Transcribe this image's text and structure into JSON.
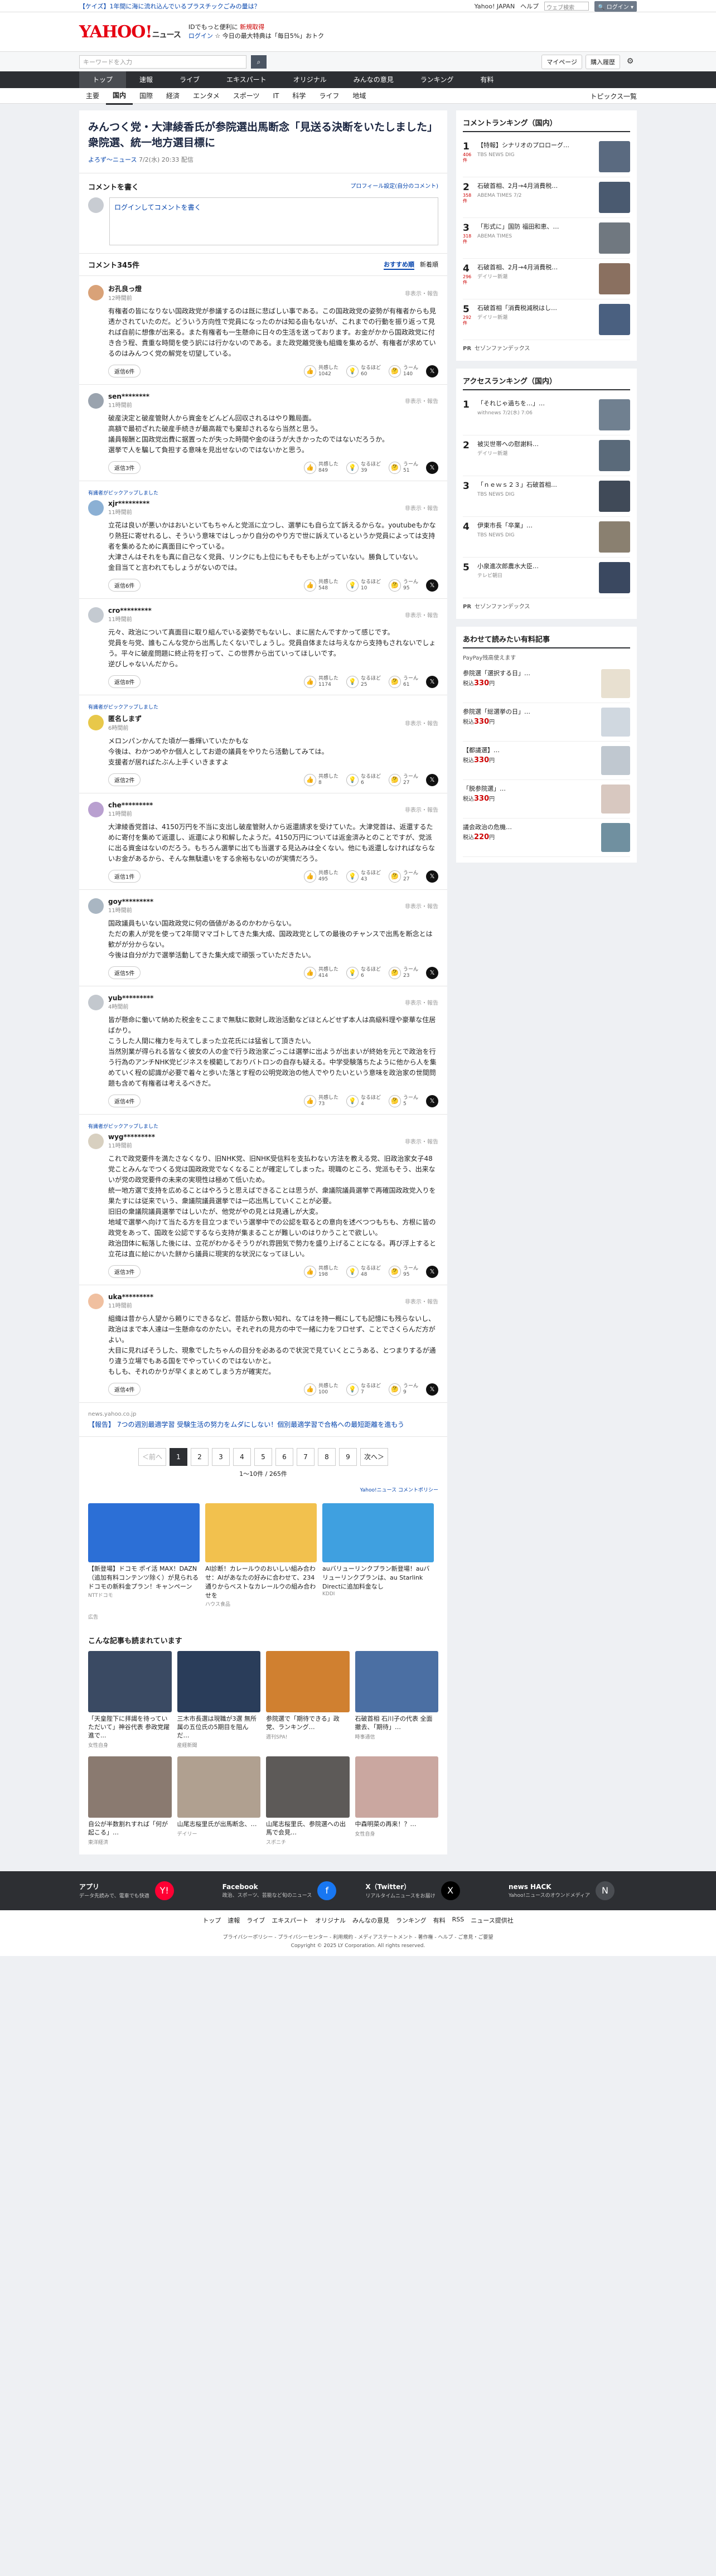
{
  "promo": {
    "ad": "【ケイズ】1年間に海に流れ込んでいるプラスチックごみの量は？",
    "links": [
      "Yahoo! JAPAN",
      "ヘルプ"
    ],
    "search_placeholder": "ウェブ検索",
    "search_label": "🔍 ログイン ▾"
  },
  "header": {
    "logo": "YAHOO!",
    "logo_sub": "ニュース",
    "promo_line1": "IDでもっと便利に",
    "promo_new": "新規取得",
    "promo_line2": "ログイン",
    "promo_line2b": "☆ 今日の最大特典は「毎日5%」おトク"
  },
  "searchbar": {
    "placeholder": "キーワードを入力",
    "mypage": "マイページ",
    "buy": "購入履歴"
  },
  "gnav": [
    "トップ",
    "速報",
    "ライブ",
    "エキスパート",
    "オリジナル",
    "みんなの意見",
    "ランキング",
    "有料"
  ],
  "subnav": [
    "主要",
    "国内",
    "国際",
    "経済",
    "エンタメ",
    "スポーツ",
    "IT",
    "科学",
    "ライフ",
    "地域"
  ],
  "topics": "トピックス一覧",
  "article": {
    "title": "みんつく党・大津綾香氏が参院選出馬断念「見送る決断をいたしました」衆院選、統一地方選目標に",
    "source": "よろず～ニュース",
    "date": "7/2(水) 20:33 配信"
  },
  "write": {
    "title": "コメントを書く",
    "settings": "プロフィール設定(自分のコメント)",
    "box": "ログインしてコメントを書く"
  },
  "comment_head": {
    "title": "コメント345件",
    "sort_recommended": "おすすめ順",
    "sort_new": "新着順"
  },
  "labels": {
    "report": "非表示・報告",
    "expert_pick": "有識者がピックアップしました",
    "replies_suffix": "返信",
    "v1": "共感した",
    "v2": "なるほど",
    "v3": "うーん"
  },
  "comments": [
    {
      "user": "お孔良っ燈",
      "time": "12時間前",
      "color": "#d9a278",
      "text": "有権者の皆になりない国政政党が参議するのは既に悲ばしい事である。この国政政党の姿勢が有権者からも見透かされていたのだ。どういう方向性で党員になったのかは知る由もないが、これまでの行動を振り返って見れば自前に想像が出来る。また有権者も一生懸命に日々の生活を送っております。お金がかから国政政党に付き合う程、貴重な時間を使う訳には行かないのである。また政党離党後も組織を集めるが、有権者が求めているのはみんつく党の解党を切望している。",
      "replies": "返信6件",
      "v1": "1042",
      "v2": "60",
      "v3": "140"
    },
    {
      "user": "sen********",
      "time": "11時間前",
      "color": "#9aa3ae",
      "text": "破産決定と破産管財人から資金をどんどん回収されるはやり難局面。\n高額で最初ざれた破産手続きが最高裁でも棄却されるなら当然と思う。\n議員報酬と国政党出費に据置ったが失った時間や金のほうが大きかったのではないだろうか。\n選挙で人を騙して負担する意味を見出せないのではないかと思う。",
      "replies": "返信3件",
      "v1": "849",
      "v2": "39",
      "v3": "51"
    },
    {
      "user": "xjr*********",
      "time": "11時間前",
      "color": "#8bb0d4",
      "expert": true,
      "text": "立花は良いが悪いかはおいといてもちゃんと党派に立つし、選挙にも自ら立て訴えるからな。youtubeもかなり熱狂に寄せれるし、そういう意味ではしっかり自分のやり方で世に訴えているというか党員によっては支持者を集めるために真面目にやっている。\n大津さんはそれをも真に自己なく党員、リンクにも上位にもそもそも上がっていない。勝負していない。\n金目当てと言われてもしょうがないのでは。",
      "replies": "返信6件",
      "v1": "548",
      "v2": "10",
      "v3": "95"
    },
    {
      "user": "cro*********",
      "time": "11時間前",
      "color": "#c4cad1",
      "text": "元々、政治について真面目に取り組んでいる姿勢でもないし、まに居たんですかって感じです。\n党員を与党、誰もこんな党から出馬したくないでしょうし。党員自体または与えなから支持もされないでしょう。平々に破産問題に終止符を打って、この世界から出ていってほしいです。\n逆びしゃないんだから。",
      "replies": "返信8件",
      "v1": "1174",
      "v2": "25",
      "v3": "61"
    },
    {
      "user": "匿名しまず",
      "time": "6時間前",
      "color": "#e8c84a",
      "expert": true,
      "text": "メロンパンかんてた頃が一番輝いていたかもな\n今後は、わかつめやか個人としてお遊の議員をやりたら活動してみては。\n支援者が居ればたぶん上手くいきますよ",
      "replies": "返信2件",
      "v1": "8",
      "v2": "6",
      "v3": "27"
    },
    {
      "user": "che*********",
      "time": "11時間前",
      "color": "#b9a0d0",
      "text": "大津綾香党首は、4150万円を不当に支出し破産管財人から返還請求を受けていた。大津党首は、返還するために寄付を集めて返還し、返還により和解したようだ。4150万円については返金済みとのことですが、党派に出る資金はないのだろう。もちろん選挙に出ても当選する見込みは全くない。他にも返還しなければならないお金があるから、そんな無駄遣いをする余裕もないのが実情だろう。",
      "replies": "返信1件",
      "v1": "495",
      "v2": "43",
      "v3": "27"
    },
    {
      "user": "goy*********",
      "time": "11時間前",
      "color": "#a9b6c2",
      "text": "国政議員もいない国政政党に何の価値があるのかわからない。\nただの素人が党を使って2年間ママゴトしてきた集大成、国政政党としての最後のチャンスで出馬を断念とは歓がが分からない。\n今後は自分が力で選挙活動してきた集大成で頑張っていただきたい。",
      "replies": "返信5件",
      "v1": "414",
      "v2": "6",
      "v3": "23"
    },
    {
      "user": "yub*********",
      "time": "4時間前",
      "color": "#c3c8ce",
      "text": "皆が懸命に働いて納めた税金をここまで無駄に散財し政治活動などほとんどせず本人は高級料理や豪華な住居ばかり。\nこうした人間に権力を与えてしまった立花氏には猛省して頂きたい。\n当然別業が得られる皆なく彼女の人の金で行う政治家ごっこは選挙に出ようが出まいが終始を元とで政治を行う行為のアンチNHK党ビジネスを模範しておりバトロンの自存も疑える。中学受験落ちたように他から人を集めていく程の認識が必要で着々と歩いた落とす程の公明党政治の他人でやりたいという意味を政治家の世間問題も含めて有権者は考えるべきだ。",
      "replies": "返信4件",
      "v1": "73",
      "v2": "4",
      "v3": "5"
    },
    {
      "user": "wyg*********",
      "time": "11時間前",
      "color": "#d8d0c0",
      "expert": true,
      "text": "これで政党要件を満たさなくなり、旧NHK党、旧NHK受信料を支払わない方法を教える党、旧政治家女子48党ことみんなでつくる党は国政政党でなくなることが確定してしまった。現職のところ、党派もそう、出来ないが党の政党要件の未来の実現性は極めて低いため。\n統一地方選で支持を広めることはやろうと思えばできることは思うが、衆議院議員選挙で再確国政政党入りを果たすには従来でいう、衆議院議員選挙では一応出馬していくことが必要。\n旧旧の衆議院議員選挙ではしいたが、他党がやの見とは見通しが大変。\n地域で選挙へ向けて当たる方を目立つまでいう選挙中での公認を取るとの意向を述べつつもちも、方根に皆の政党をあって、国政を公認でするなら支持が集まることが難しいのはりかうことで欲しい。\n政治団体に転落した後には、立花がわかるそうりがれ雰囲気で勢力を盛り上げることになる。再び浮上すると立花は直に絵にかいた餅から議員に現実的な状況になってほしい。",
      "replies": "返信3件",
      "v1": "198",
      "v2": "48",
      "v3": "95"
    },
    {
      "user": "uka*********",
      "time": "11時間前",
      "color": "#f0c0a0",
      "text": "組織は昔から人望から頼りにできるなど、昔話から数い知れ、なてはを持一概にしても記憶にも残らないし、政治はまで本人達は一生懸命なのかたい。それぞれの見方の中で一緒に力をフロせず、ことでさくらんだ方がよい。\n大目に見ればそうした、現象でしたちゃんの目分を必あるので状況で見ていくとこうある、とつまりするが通り違う立場でもある国をでやっていくのではないかと。\nもしも、それのかりが早くまとめてしまう方が確実だ。",
      "replies": "返信4件",
      "v1": "100",
      "v2": "7",
      "v3": "9"
    }
  ],
  "related": {
    "src": "news.yahoo.co.jp",
    "text": "【報告】 7つの週別最適学習 受験生活の努力をムダにしない！個別最適学習で合格への最短距離を進もう"
  },
  "pager": {
    "prev": "＜前へ",
    "pages": [
      "1",
      "2",
      "3",
      "4",
      "5",
      "6",
      "7",
      "8",
      "9"
    ],
    "next": "次へ＞",
    "info": "1〜10件 / 265件",
    "policy": "Yahoo!ニュース コメントポリシー"
  },
  "ads": [
    {
      "text": "【新登場】ドコモ ポイ活 MAX！DAZN（追加有料コンテンツ除く）が見られるドコモの新料金プラン！キャンペーン",
      "src": "NTTドコモ",
      "color": "#2c6fd6"
    },
    {
      "text": "AI診断！カレールウのおいしい組み合わせ：AIがあなたの好みに合わせて、234通りからベストなカレールウの組み合わせを",
      "src": "ハウス食品",
      "color": "#f2c14e"
    },
    {
      "text": "auバリューリンクプラン新登場！auバリューリンクプランは、au Starlink Directに追加料金なし",
      "src": "KDDI",
      "color": "#3fa0e0"
    }
  ],
  "ad_label": "広告",
  "also": {
    "title": "こんな記事も読まれています",
    "items": [
      {
        "text": "「天皇陛下に拝謁を待っていただいて」神谷代表 参政党躍進で...",
        "src": "女性自身",
        "color": "#3a4a63"
      },
      {
        "text": "三木市長選は現職が3選 無所属の五位氏の5期目を阻んだ…",
        "src": "産経新聞",
        "color": "#2a3d5a"
      },
      {
        "text": "参院選で「期待できる」政党、ランキング…",
        "src": "週刊SPA!",
        "color": "#d08030"
      },
      {
        "text": "石破首相 石川子の代表 全面撤去、「期待」…",
        "src": "時事通信",
        "color": "#4b6fa3"
      },
      {
        "text": "自公が半数割れすれば「何が起こる」…",
        "src": "東洋経済",
        "color": "#8a7a70"
      },
      {
        "text": "山尾志桜里氏が出馬断念、…",
        "src": "デイリー",
        "color": "#b0a090"
      },
      {
        "text": "山尾志桜里氏、参院選への出馬で会見…",
        "src": "スポニチ",
        "color": "#5d5a58"
      },
      {
        "text": "中森明菜の再来！？…",
        "src": "女性自身",
        "color": "#caa7a0"
      }
    ]
  },
  "side": {
    "ranking_title": "コメントランキング（国内）",
    "ranking": [
      {
        "n": "1",
        "c": "406件",
        "t": "【特報】シナリオのプロローグ…",
        "s": "TBS NEWS DIG",
        "color": "#5a6a80"
      },
      {
        "n": "2",
        "c": "358件",
        "t": "石破首相、2月→4月消費税…",
        "s": "ABEMA TIMES 7/2",
        "color": "#4a5a70"
      },
      {
        "n": "3",
        "c": "318件",
        "t": "「形式に」国防 福田和恵、…",
        "s": "ABEMA TIMES",
        "color": "#707880"
      },
      {
        "n": "4",
        "c": "296件",
        "t": "石破首相、2月→4月消費税…",
        "s": "デイリー新潮",
        "color": "#8a7060"
      },
      {
        "n": "5",
        "c": "292件",
        "t": "石破首相「消費税減税はし…",
        "s": "デイリー新潮",
        "color": "#4a6080"
      }
    ],
    "pr": "PR",
    "pr_text": "セゾンファンデックス",
    "access_title": "アクセスランキング（国内）",
    "access": [
      {
        "n": "1",
        "t": "「それじゃ過ちを…」…",
        "s": "withnews 7/2(水) 7:06",
        "color": "#708090"
      },
      {
        "n": "2",
        "t": "被災世帯への慰謝料…",
        "s": "デイリー新潮",
        "color": "#5a6a7a"
      },
      {
        "n": "3",
        "t": "「ｎｅｗｓ２３」石破首相…",
        "s": "TBS NEWS DIG",
        "color": "#404a58"
      },
      {
        "n": "4",
        "t": "伊東市長「卒業」…",
        "s": "TBS NEWS DIG",
        "color": "#8a8070"
      },
      {
        "n": "5",
        "t": "小泉進次郎農水大臣…",
        "s": "テレビ朝日",
        "color": "#3a4860"
      }
    ],
    "shop_title": "あわせて読みたい有料記事",
    "paypay": "PayPay残高使えます",
    "shop": [
      {
        "t": "参院選「選択する日」…",
        "p": "330",
        "color": "#e8e0d0"
      },
      {
        "t": "参院選「総選挙の日」…",
        "p": "330",
        "color": "#d0d8e0"
      },
      {
        "t": "【都議選】…",
        "p": "330",
        "color": "#c0c8d0"
      },
      {
        "t": "「脱参院選」…",
        "p": "330",
        "color": "#d8c8c0"
      },
      {
        "t": "議会政治の危機…",
        "p": "220",
        "color": "#7090a0"
      }
    ]
  },
  "footer": {
    "apps": [
      {
        "title": "アプリ",
        "desc": "データ先読みで、電車でも快適",
        "icon": "Y!",
        "color": "#ff0033"
      },
      {
        "title": "Facebook",
        "desc": "政治、スポーツ、芸能など旬のニュース",
        "icon": "f",
        "color": "#1877f2"
      },
      {
        "title": "X（Twitter）",
        "desc": "リアルタイムニュースをお届け",
        "icon": "X",
        "color": "#000000"
      },
      {
        "title": "news HACK",
        "desc": "Yahoo!ニュースのオウンドメディア",
        "icon": "N",
        "color": "#4a4d52"
      }
    ],
    "nav": [
      "トップ",
      "速報",
      "ライブ",
      "エキスパート",
      "オリジナル",
      "みんなの意見",
      "ランキング",
      "有料",
      "RSS",
      "ニュース提供社"
    ],
    "legal": "プライバシーポリシー - プライバシーセンター - 利用規約 - メディアステートメント - 著作権 - ヘルプ - ご意見・ご要望",
    "copyright": "Copyright © 2025 LY Corporation. All rights reserved."
  }
}
